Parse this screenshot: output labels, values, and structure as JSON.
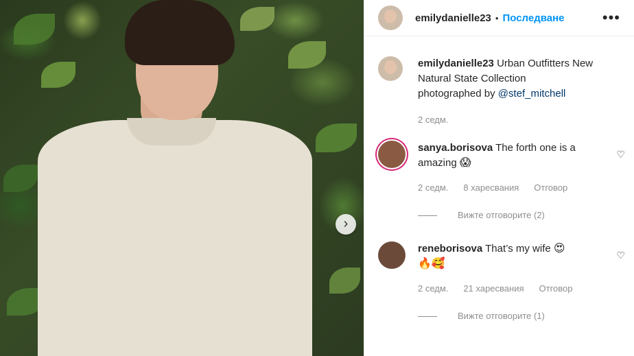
{
  "post": {
    "author": "emilydanielle23",
    "separator": "•",
    "follow_label": "Последване",
    "more_label": "•••",
    "next_label": "›"
  },
  "caption": {
    "username": "emilydanielle23",
    "text_line1": "Urban Outfitters New",
    "text_line2": "Natural State Collection",
    "text_line3": "photographed by",
    "mention": "@stef_mitchell",
    "time": "2 седм."
  },
  "comments": [
    {
      "username": "sanya.borisova",
      "text": "The forth one is a",
      "text2": "amazing",
      "emoji": "😱",
      "time": "2 седм.",
      "likes": "8 харесвания",
      "reply_label": "Отговор",
      "view_replies": "Вижте отговорите (2)"
    },
    {
      "username": "reneborisova",
      "text": "That’s my wife",
      "emoji": "😍",
      "emoji2": "🔥🥰",
      "time": "2 седм.",
      "likes": "21 харесвания",
      "reply_label": "Отговор",
      "view_replies": "Вижте отговорите (1)"
    }
  ],
  "icons": {
    "heart": "♡"
  }
}
